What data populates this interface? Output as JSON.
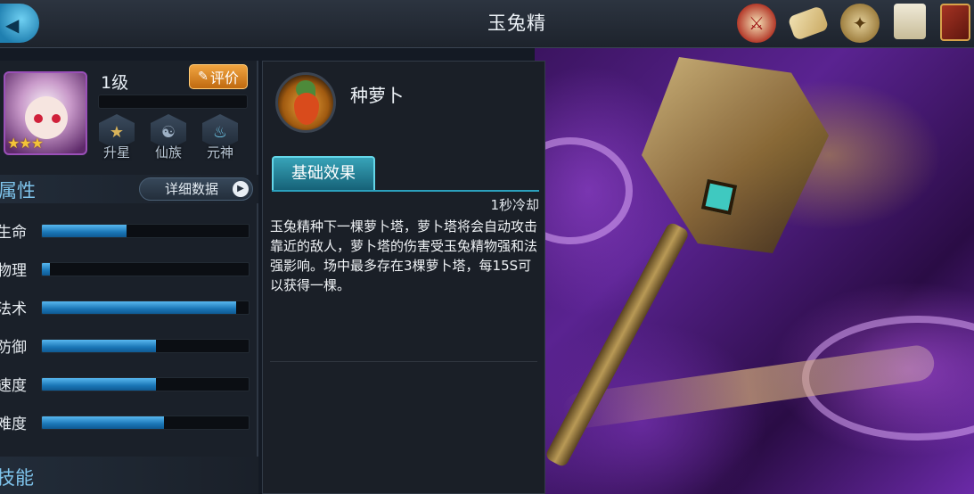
{
  "header": {
    "title": "玉兔精",
    "top_icons": [
      "battle-seal-icon",
      "scroll-icon",
      "medal-coin-icon",
      "document-icon",
      "book-icon"
    ]
  },
  "hero": {
    "level": "1级",
    "stars": "★★★",
    "rate_button": "评价",
    "exp_progress": 0,
    "badges": [
      "升星",
      "仙族",
      "元神"
    ]
  },
  "attributes": {
    "title": "属性",
    "detail_button": "详细数据",
    "stats": [
      {
        "label": "生命",
        "value": 0.41
      },
      {
        "label": "物理",
        "value": 0.04
      },
      {
        "label": "法术",
        "value": 0.94
      },
      {
        "label": "防御",
        "value": 0.55
      },
      {
        "label": "速度",
        "value": 0.55
      },
      {
        "label": "难度",
        "value": 0.59
      }
    ]
  },
  "skills": {
    "title": "技能"
  },
  "skill_detail": {
    "name": "种萝卜",
    "tab": "基础效果",
    "cooldown": "1秒冷却",
    "description": "玉兔精种下一棵萝卜塔，萝卜塔将会自动攻击靠近的敌人，萝卜塔的伤害受玉兔精物强和法强影响。场中最多存在3棵萝卜塔，每15S可以获得一棵。"
  },
  "colors": {
    "accent": "#7fc4ec",
    "bar_fill": "#1a76b6",
    "rate_button": "#e08a28",
    "tab": "#2a8ea6"
  }
}
